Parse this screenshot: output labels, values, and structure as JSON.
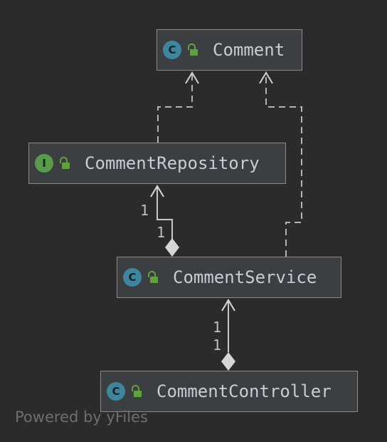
{
  "nodes": [
    {
      "id": "comment",
      "kind": "C",
      "kind_name": "class",
      "label": "Comment"
    },
    {
      "id": "repository",
      "kind": "I",
      "kind_name": "interface",
      "label": "CommentRepository"
    },
    {
      "id": "service",
      "kind": "C",
      "kind_name": "class",
      "label": "CommentService"
    },
    {
      "id": "controller",
      "kind": "C",
      "kind_name": "class",
      "label": "CommentController"
    }
  ],
  "edges": [
    {
      "from": "repository",
      "to": "comment",
      "type": "dependency"
    },
    {
      "from": "service",
      "to": "comment",
      "type": "dependency"
    },
    {
      "from": "service",
      "to": "repository",
      "type": "aggregation",
      "target_multiplicity": "1",
      "source_multiplicity": "1"
    },
    {
      "from": "controller",
      "to": "service",
      "type": "aggregation",
      "target_multiplicity": "1",
      "source_multiplicity": "1"
    }
  ],
  "access_icon": "unlocked-padlock-icon",
  "colors": {
    "background": "#2b2b2b",
    "node_fill": "#3c3f41",
    "class_badge": "#3e86a0",
    "interface_badge": "#5a9a4b",
    "lock": "#5ea33a"
  },
  "watermark": "Powered by yFiles"
}
